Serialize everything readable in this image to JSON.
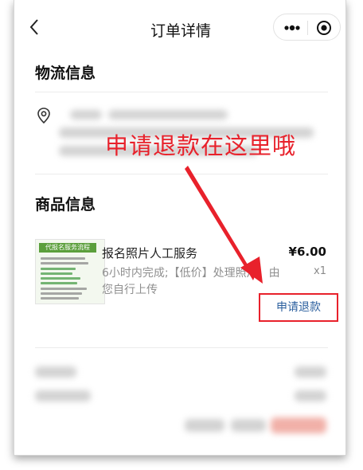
{
  "header": {
    "title": "订单详情",
    "back_icon": "chevron-left-icon",
    "more_icon": "more-dots-icon",
    "close_icon": "target-circle-icon"
  },
  "logistics": {
    "title": "物流信息",
    "location_icon": "location-pin-icon"
  },
  "annotation": {
    "text": "申请退款在这里哦",
    "color": "#e8212b"
  },
  "goods": {
    "title": "商品信息",
    "thumbnail_title": "代报名服务流程",
    "product_name": "报名照片人工服务",
    "description": "6小时内完成;【低价】处理照片，由您自行上传",
    "price": "¥6.00",
    "quantity": "x1",
    "refund_label": "申请退款"
  },
  "colors": {
    "accent_red": "#e8212b",
    "link_blue": "#2b5f9e"
  }
}
